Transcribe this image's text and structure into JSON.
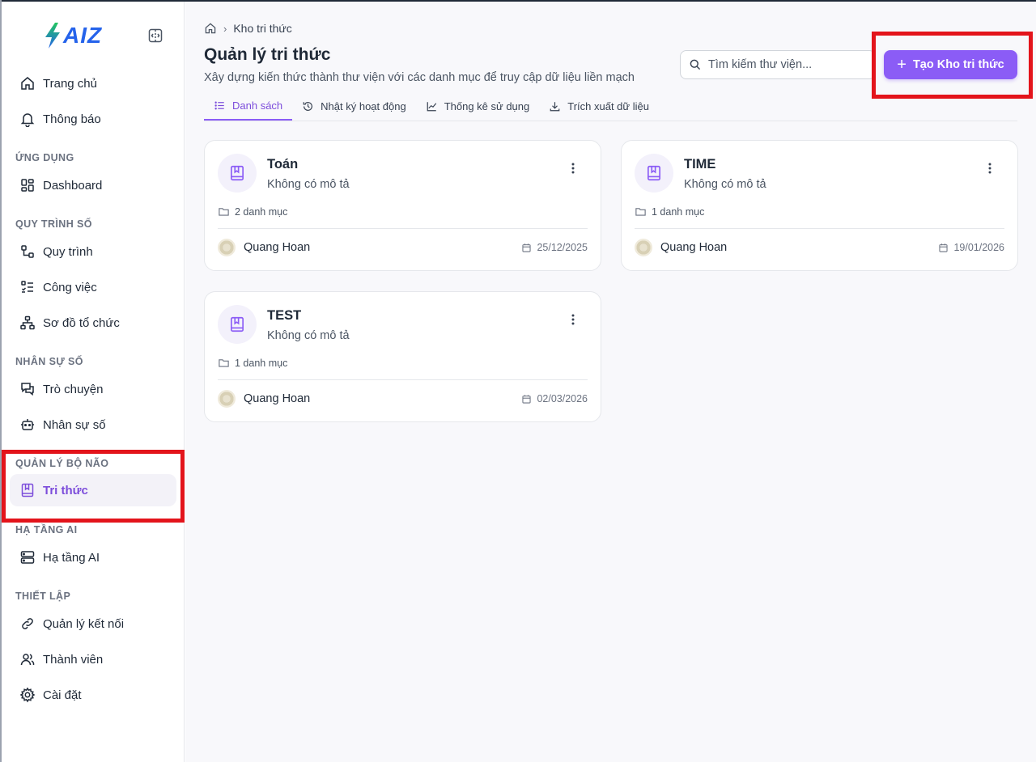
{
  "brand": {
    "logo_text": "AIZ"
  },
  "sidebar": {
    "top_items": [
      {
        "label": "Trang chủ"
      },
      {
        "label": "Thông báo"
      }
    ],
    "sections": [
      {
        "title": "ỨNG DỤNG",
        "items": [
          {
            "label": "Dashboard"
          }
        ]
      },
      {
        "title": "QUY TRÌNH SỐ",
        "items": [
          {
            "label": "Quy trình"
          },
          {
            "label": "Công việc"
          },
          {
            "label": "Sơ đồ tổ chức"
          }
        ]
      },
      {
        "title": "NHÂN SỰ SỐ",
        "items": [
          {
            "label": "Trò chuyện"
          },
          {
            "label": "Nhân sự số"
          }
        ]
      },
      {
        "title": "QUẢN LÝ BỘ NÃO",
        "items": [
          {
            "label": "Tri thức",
            "active": true
          }
        ]
      },
      {
        "title": "HẠ TẦNG AI",
        "items": [
          {
            "label": "Hạ tầng AI"
          }
        ]
      },
      {
        "title": "THIẾT LẬP",
        "items": [
          {
            "label": "Quản lý kết nối"
          },
          {
            "label": "Thành viên"
          },
          {
            "label": "Cài đặt"
          }
        ]
      }
    ]
  },
  "breadcrumb": {
    "current": "Kho tri thức"
  },
  "header": {
    "title": "Quản lý tri thức",
    "description": "Xây dựng kiến thức thành thư viện với các danh mục để truy cập dữ liệu liền mạch"
  },
  "search": {
    "placeholder": "Tìm kiếm thư viện...",
    "value": ""
  },
  "create_button": {
    "label": "Tạo Kho tri thức"
  },
  "tabs": [
    {
      "label": "Danh sách",
      "active": true
    },
    {
      "label": "Nhật ký hoạt động"
    },
    {
      "label": "Thống kê sử dụng"
    },
    {
      "label": "Trích xuất dữ liệu"
    }
  ],
  "cards": [
    {
      "title": "Toán",
      "description": "Không có mô tả",
      "categories": "2 danh mục",
      "author": "Quang Hoan",
      "date": "25/12/2025"
    },
    {
      "title": "TIME",
      "description": "Không có mô tả",
      "categories": "1 danh mục",
      "author": "Quang Hoan",
      "date": "19/01/2026"
    },
    {
      "title": "TEST",
      "description": "Không có mô tả",
      "categories": "1 danh mục",
      "author": "Quang Hoan",
      "date": "02/03/2026"
    }
  ],
  "colors": {
    "accent": "#8b5cf6",
    "highlight": "#e3141b"
  }
}
